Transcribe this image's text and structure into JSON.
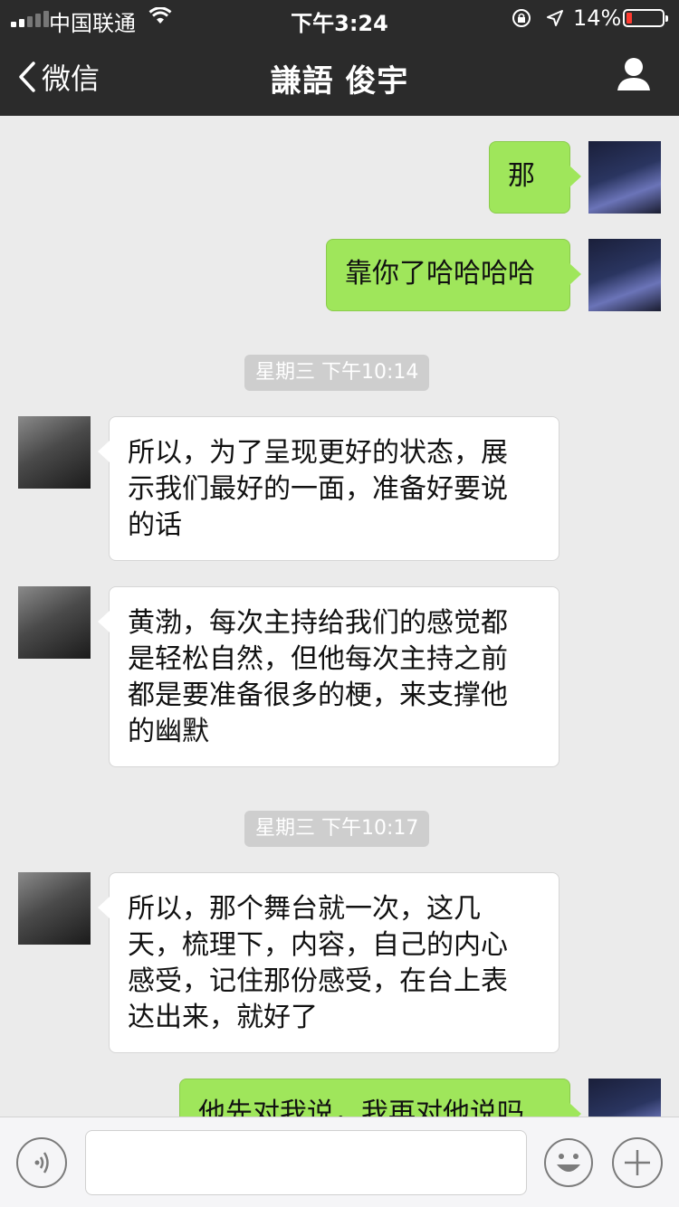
{
  "status_bar": {
    "carrier": "中国联通",
    "time": "下午3:24",
    "battery_percent": "14%",
    "battery_color": "#ff3b30",
    "signal_bars": 2,
    "icons": [
      "signal-icon",
      "wifi-icon",
      "orientation-lock-icon",
      "location-arrow-icon",
      "battery-icon"
    ]
  },
  "nav": {
    "back_label": "微信",
    "title": "謙語 俊宇",
    "icons": [
      "back-chevron-icon",
      "profile-icon"
    ]
  },
  "timestamps": [
    "星期三 下午10:14",
    "星期三 下午10:17"
  ],
  "messages": [
    {
      "from": "self",
      "text": "那"
    },
    {
      "from": "self",
      "text": "靠你了哈哈哈哈"
    },
    {
      "from": "other",
      "lines": [
        "所以，为了呈现更好的状态，展",
        "示我们最好的一面，准备好要说",
        "的话"
      ]
    },
    {
      "from": "other",
      "lines": [
        "黄渤，每次主持给我们的感觉都",
        "是轻松自然，但他每次主持之前",
        "都是要准备很多的梗，来支撑他",
        "的幽默"
      ]
    },
    {
      "from": "other",
      "lines": [
        "所以，那个舞台就一次，这几",
        "天，梳理下，内容，自己的内心",
        "感受，记住那份感受，在台上表",
        "达出来，就好了"
      ]
    },
    {
      "from": "self",
      "text": "他先对我说，我再对他说吗"
    }
  ],
  "colors": {
    "header_bg": "#2b2b2b",
    "chat_bg": "#ebebeb",
    "outgoing_bubble": "#9fe65b",
    "incoming_bubble": "#ffffff"
  },
  "input_bar": {
    "icons": [
      "voice-icon",
      "emoji-icon",
      "plus-icon"
    ]
  }
}
